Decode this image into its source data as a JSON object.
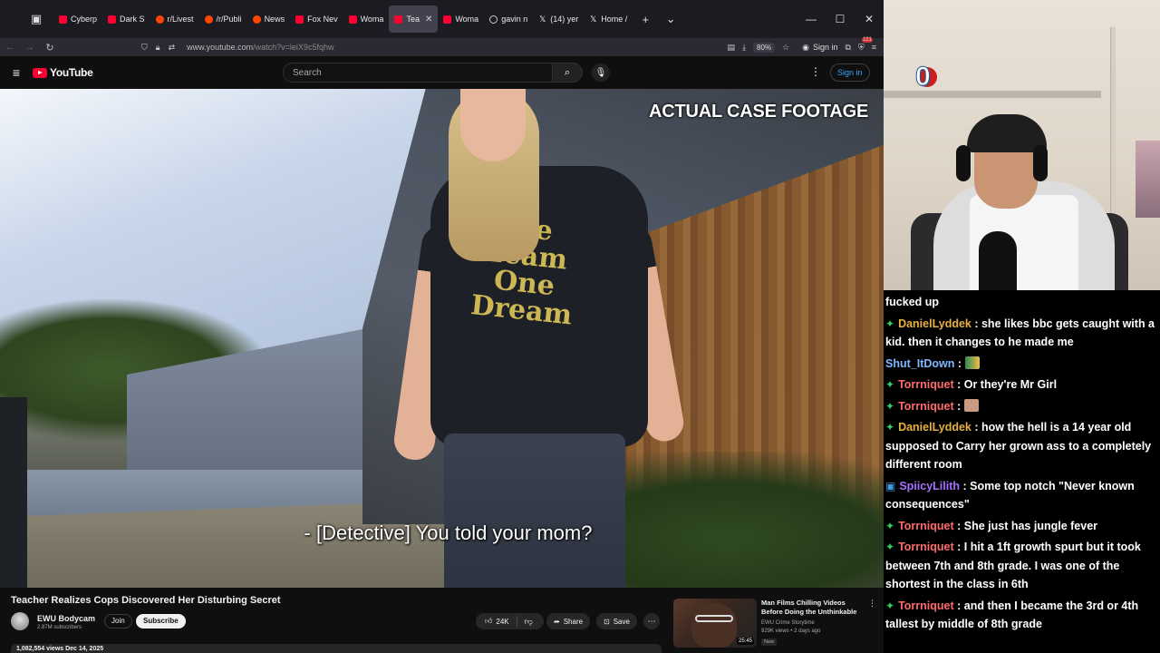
{
  "browser": {
    "tabs": [
      {
        "label": "Cyberp",
        "icon": "youtube-favicon-icon",
        "active": false
      },
      {
        "label": "Dark S",
        "icon": "youtube-favicon-icon",
        "active": false
      },
      {
        "label": "r/Livest",
        "icon": "reddit-favicon-icon",
        "active": false
      },
      {
        "label": "/r/Publi",
        "icon": "reddit-favicon-icon",
        "active": false
      },
      {
        "label": "News",
        "icon": "reddit-favicon-icon",
        "active": false
      },
      {
        "label": "Fox Nev",
        "icon": "youtube-favicon-icon",
        "active": false
      },
      {
        "label": "Woma",
        "icon": "youtube-favicon-icon",
        "active": false
      },
      {
        "label": "Tea",
        "icon": "youtube-favicon-icon",
        "active": true
      },
      {
        "label": "Woma",
        "icon": "youtube-favicon-icon",
        "active": false
      },
      {
        "label": "gavin n",
        "icon": "google-favicon-icon",
        "active": false
      },
      {
        "label": "(14) yer",
        "icon": "x-favicon-icon",
        "active": false
      },
      {
        "label": "Home /",
        "icon": "x-favicon-icon",
        "active": false
      }
    ],
    "url_prefix": "www.youtube.com",
    "url_path": "/watch?v=leiX9c5fqhw",
    "zoom": "80%",
    "signin_label": "Sign in",
    "extension_count": "121"
  },
  "youtube": {
    "logo_text": "YouTube",
    "search_placeholder": "Search",
    "signin_label": "Sign in",
    "video": {
      "overlay_label": "ACTUAL CASE FOOTAGE",
      "caption": "- [Detective] You told your mom?",
      "shirt_text": "We Team One Dream"
    },
    "title": "Teacher Realizes Cops Discovered Her Disturbing Secret",
    "channel": {
      "name": "EWU Bodycam",
      "subscribers": "2.87M subscribers"
    },
    "join_label": "Join",
    "subscribe_label": "Subscribe",
    "likes": "24K",
    "share_label": "Share",
    "save_label": "Save",
    "views_date": "1,082,554 views  Dec 14, 2025",
    "recommended": {
      "title": "Man Films Chilling Videos Before Doing the Unthinkable",
      "channel": "EWU Crime Storytime",
      "meta": "929K views • 2 days ago",
      "badge": "New",
      "duration": "25:45"
    }
  },
  "overlay": {
    "counter": "0"
  },
  "chat": {
    "colors": {
      "green": "#33cc66",
      "orange": "#e8a040",
      "purple": "#a970ff",
      "blue": "#7fb8ff"
    },
    "messages": [
      {
        "badge": "",
        "user": "",
        "text": "fucked up",
        "color": "#ffffff"
      },
      {
        "badge": "kick",
        "user": "DanielLyddek",
        "text": " : she likes bbc gets caught with a kid. then it changes to he made me",
        "color": "#e8b040"
      },
      {
        "badge": "",
        "user": "Shut_ItDown",
        "text": " : ",
        "color": "#7fb8ff",
        "emote": "e1"
      },
      {
        "badge": "kick",
        "user": "Torrniquet",
        "text": " : Or they're Mr Girl",
        "color": "#ff6a6a"
      },
      {
        "badge": "kick",
        "user": "Torrniquet",
        "text": " : ",
        "color": "#ff6a6a",
        "emote": "e2"
      },
      {
        "badge": "kick",
        "user": "DanielLyddek",
        "text": " : how the hell is a 14 year old supposed to Carry her grown ass to a completely different room",
        "color": "#e8b040"
      },
      {
        "badge": "twitch",
        "user": "SpiicyLilith",
        "text": " : Some top notch \"Never known consequences\"",
        "color": "#a970ff"
      },
      {
        "badge": "kick",
        "user": "Torrniquet",
        "text": " : She just has jungle fever",
        "color": "#ff6a6a"
      },
      {
        "badge": "kick",
        "user": "Torrniquet",
        "text": " : I hit a 1ft growth spurt but it took between 7th and 8th grade. I was one of the shortest in the class in 6th",
        "color": "#ff6a6a"
      },
      {
        "badge": "kick",
        "user": "Torrniquet",
        "text": " : and then I became the 3rd or 4th tallest by middle of 8th grade",
        "color": "#ff6a6a"
      }
    ]
  }
}
